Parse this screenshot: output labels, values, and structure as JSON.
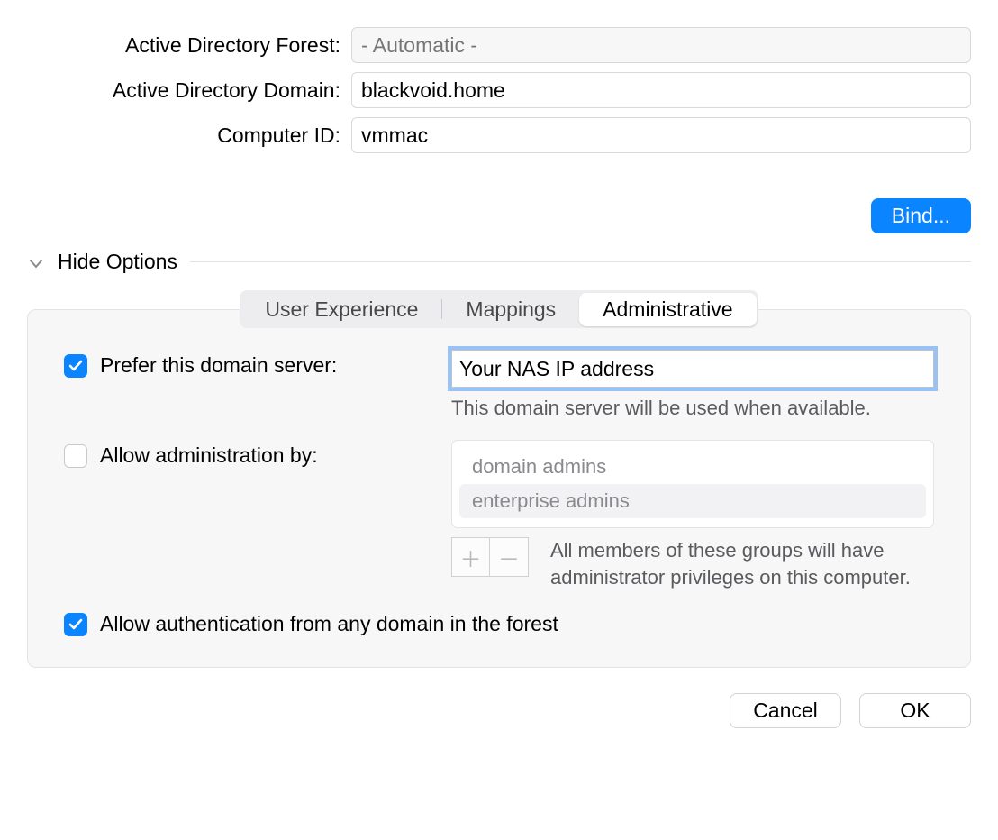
{
  "fields": {
    "ad_forest_label": "Active Directory Forest:",
    "ad_forest_placeholder": "- Automatic -",
    "ad_domain_label": "Active Directory Domain:",
    "ad_domain_value": "blackvoid.home",
    "computer_id_label": "Computer ID:",
    "computer_id_value": "vmmac"
  },
  "buttons": {
    "bind": "Bind...",
    "cancel": "Cancel",
    "ok": "OK",
    "plus": "＋",
    "minus": "－"
  },
  "hide_options_label": "Hide Options",
  "tabs": {
    "user_experience": "User Experience",
    "mappings": "Mappings",
    "administrative": "Administrative"
  },
  "administrative": {
    "prefer_server_label": "Prefer this domain server:",
    "prefer_server_value": "Your NAS IP address",
    "prefer_server_help": "This domain server will be used when available.",
    "allow_admin_label": "Allow administration by:",
    "admin_groups": {
      "0": "domain admins",
      "1": "enterprise admins"
    },
    "admin_groups_help": "All members of these groups will have administrator privileges on this computer.",
    "allow_any_domain_label": "Allow authentication from any domain in the forest"
  }
}
